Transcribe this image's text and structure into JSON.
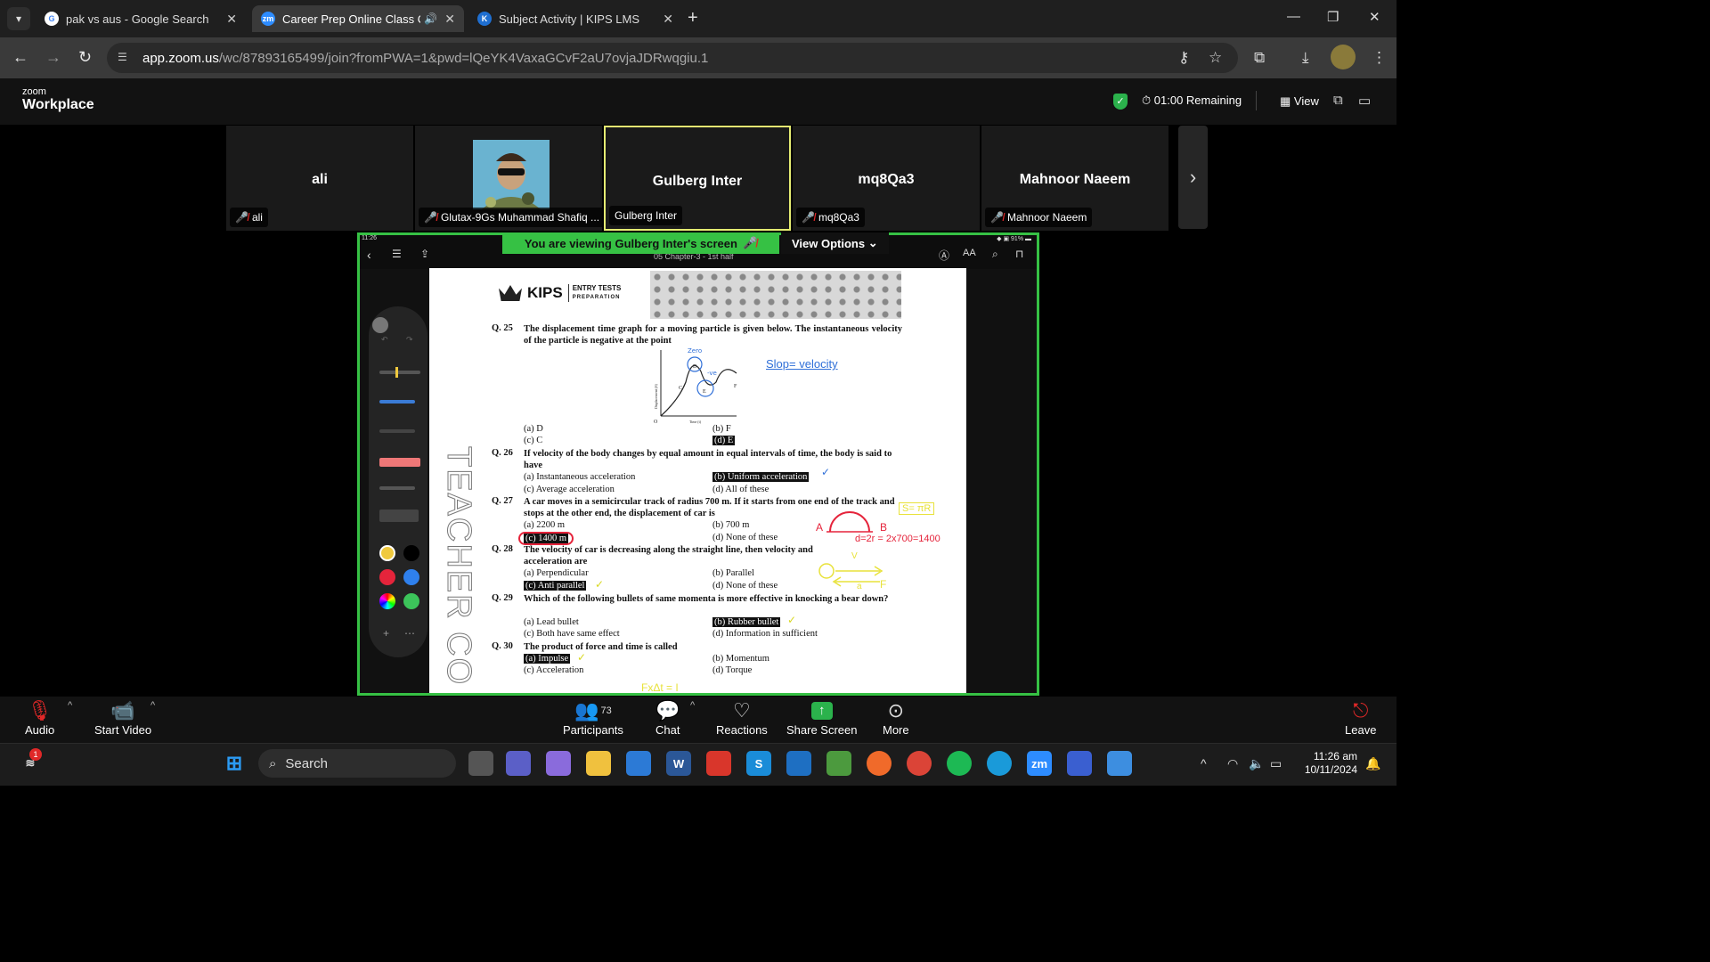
{
  "browser": {
    "tabs": [
      {
        "title": "pak vs aus - Google Search"
      },
      {
        "title": "Career Prep Online Class Oc"
      },
      {
        "title": "Subject Activity | KIPS LMS"
      }
    ],
    "url_host": "app.zoom.us",
    "url_rest": "/wc/87893165499/join?fromPWA=1&pwd=lQeYK4VaxaGCvF2aU7ovjaJDRwqgiu.1"
  },
  "zoom": {
    "logo_small": "zoom",
    "logo_big": "Workplace",
    "remaining": "01:00 Remaining",
    "view_label": "View"
  },
  "participants_strip": [
    {
      "name": "ali",
      "label": "ali"
    },
    {
      "name": "",
      "label": "Glutax-9Gs Muhammad Shafiq ..."
    },
    {
      "name": "Gulberg Inter",
      "label": "Gulberg Inter"
    },
    {
      "name": "mq8Qa3",
      "label": "mq8Qa3"
    },
    {
      "name": "Mahnoor Naeem",
      "label": "Mahnoor Naeem"
    }
  ],
  "share": {
    "banner": "You are viewing  Gulberg Inter's screen",
    "view_options": "View Options",
    "ipad_time": "11:26",
    "ipad_battery": "91%",
    "doc_title": "05 Chapter-3 - 1st half",
    "watermark": "TEACHER CO"
  },
  "page": {
    "brand": "KIPS",
    "brand_sub1": "ENTRY TESTS",
    "brand_sub2": "PREPARATION",
    "q25": {
      "num": "Q. 25",
      "text": "The displacement time graph for a moving particle is given below. The instantaneous velocity of the particle is negative at the point",
      "a": "(a) D",
      "b": "(b) F",
      "c": "(c) C",
      "d": "(d) E"
    },
    "graph": {
      "ylabel": "Displacement (S)",
      "xlabel": "Time (t)",
      "origin": "O",
      "points": [
        "C",
        "D",
        "E",
        "F"
      ]
    },
    "q26": {
      "num": "Q. 26",
      "text": "If velocity of the body changes by equal amount in equal intervals of time, the body is said to have",
      "a": "(a) Instantaneous acceleration",
      "b": "(b) Uniform acceleration",
      "c": "(c) Average acceleration",
      "d": "(d) All of these"
    },
    "q27": {
      "num": "Q. 27",
      "text": "A car moves in a semicircular track of radius 700 m. If it starts from one end of the track and stops at the other end, the displacement of car is",
      "a": "(a) 2200 m",
      "b": "(b) 700 m",
      "c": "(c) 1400 m",
      "d": "(d) None of these"
    },
    "q28": {
      "num": "Q. 28",
      "text": "The velocity of car is decreasing along the straight line, then velocity and acceleration are",
      "a": "(a) Perpendicular",
      "b": "(b) Parallel",
      "c": "(c) Anti parallel",
      "d": "(d) None of these"
    },
    "q29": {
      "num": "Q. 29",
      "text": "Which of the following bullets of same momenta is more effective in knocking a bear down?",
      "a": "(a) Lead bullet",
      "b": "(b) Rubber bullet",
      "c": "(c) Both have same effect",
      "d": "(d) Information in sufficient"
    },
    "q30": {
      "num": "Q. 30",
      "text": "The product of force and time is called",
      "a": "(a) Impulse",
      "b": "(b) Momentum",
      "c": "(c) Acceleration",
      "d": "(d) Torque"
    },
    "annotations": {
      "slope": "Slop= velocity",
      "zero": "Zero",
      "neg": "-ve",
      "formula": "S= πR",
      "disp": "d=2r = 2x700=1400",
      "A": "A",
      "B": "B",
      "V": "V",
      "a": "a",
      "F": "F",
      "bottom": "FxΔt = I"
    }
  },
  "footer": {
    "audio": "Audio",
    "video": "Start Video",
    "participants": "Participants",
    "participants_count": "73",
    "chat": "Chat",
    "reactions": "Reactions",
    "share": "Share Screen",
    "more": "More",
    "leave": "Leave"
  },
  "taskbar": {
    "search": "Search",
    "time": "11:26 am",
    "date": "10/11/2024",
    "notif": "1"
  },
  "colors": {
    "zoom_green": "#36c144",
    "speaker_border": "#e5ec72",
    "muted_red": "#e02828"
  }
}
